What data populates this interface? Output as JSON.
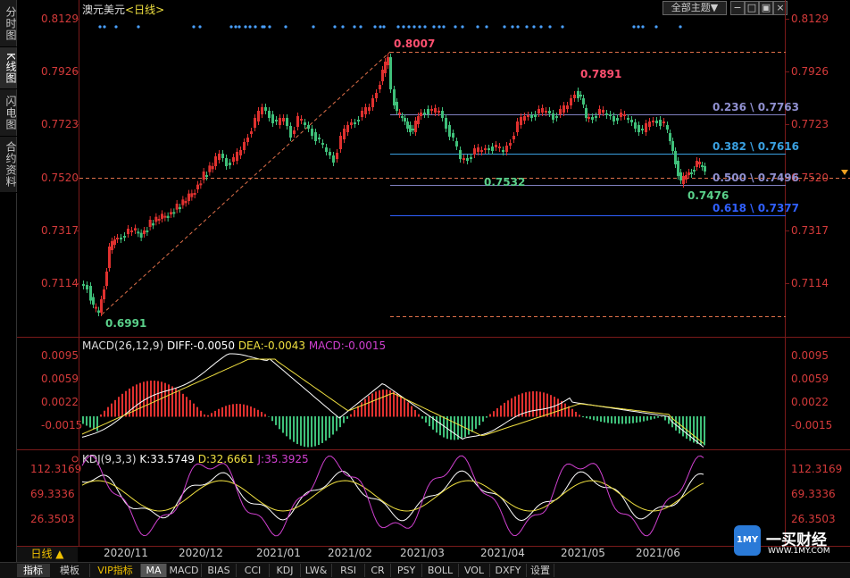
{
  "instrument_title": "澳元美元",
  "period_label": "<日线>",
  "left_tabs": [
    "分时图",
    "K线图",
    "闪电图",
    "合约资料"
  ],
  "top_right": {
    "theme_button": "全部主题▼"
  },
  "price_axis": [
    "0.8129",
    "0.7926",
    "0.7723",
    "0.7520",
    "0.7317",
    "0.7114"
  ],
  "price_annotations": {
    "high": "0.8007",
    "high2": "0.7891",
    "low": "0.6991",
    "low2": "0.7532",
    "low3": "0.7476"
  },
  "fib_levels": [
    {
      "label": "0.236 \\ 0.7763",
      "color": "#8080c0"
    },
    {
      "label": "0.382 \\ 0.7616",
      "color": "#3aa0e0"
    },
    {
      "label": "0.500 \\ 0.7496",
      "color": "#8080c0"
    },
    {
      "label": "0.618 \\ 0.7377",
      "color": "#3060ff"
    }
  ],
  "macd": {
    "title": "MACD(26,12,9)",
    "diff": "DIFF:-0.0050",
    "dea": "DEA:-0.0043",
    "macd": "MACD:-0.0015",
    "axis": [
      "0.0095",
      "0.0059",
      "0.0022",
      "-0.0015"
    ]
  },
  "kdj": {
    "title": "KDJ(9,3,3)",
    "k": "K:33.5749",
    "d": "D:32.6661",
    "j": "J:35.3925",
    "axis": [
      "112.3169",
      "69.3336",
      "26.3503"
    ]
  },
  "dates": [
    "2020/11",
    "2020/12",
    "2021/01",
    "2021/02",
    "2021/03",
    "2021/04",
    "2021/05",
    "2021/06"
  ],
  "period_button": "日线 ▲",
  "bottom_tabs": [
    "指标",
    "模板",
    "VIP指标",
    "MA",
    "MACD",
    "BIAS",
    "CCI",
    "KDJ",
    "LW&",
    "RSI",
    "CR",
    "PSY",
    "BOLL",
    "VOL",
    "DXFY",
    "设置"
  ],
  "watermark": {
    "name": "一买财经",
    "url": "WWW.1MY.COM"
  },
  "colors": {
    "up": "#e0312f",
    "down": "#3fc07a",
    "axis": "#d43a3a",
    "diff": "#ffffff",
    "dea": "#f0e040",
    "macd": "#d040d0"
  }
}
